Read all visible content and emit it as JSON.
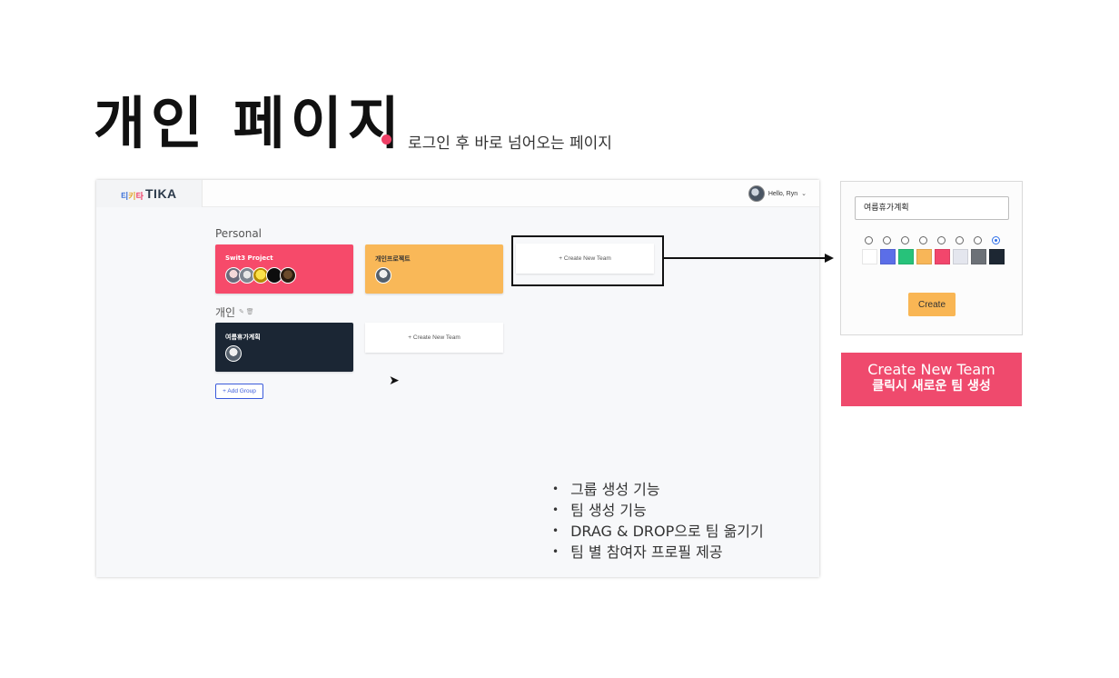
{
  "slide": {
    "title": "개인 페이지",
    "subtitle": "로그인 후 바로 넘어오는 페이지"
  },
  "app": {
    "logo_kr_1": "티",
    "logo_kr_2": "키",
    "logo_kr_3": "타",
    "logo_en": "TIKA",
    "greeting": "Hello, Ryn",
    "groups": [
      {
        "label": "Personal",
        "teams": [
          {
            "name": "Swit3 Project",
            "color": "#f64a6a"
          },
          {
            "name": "개인프로젝트",
            "color": "#f9b858"
          }
        ],
        "create_label": "+ Create New Team"
      },
      {
        "label": "개인",
        "teams": [
          {
            "name": "여름휴가계획",
            "color": "#1b2634"
          }
        ],
        "create_label": "+ Create New Team"
      }
    ],
    "edit_icons": "✎ 🗑",
    "add_group_label": "+ Add Group"
  },
  "features": [
    "그룹 생성 기능",
    "팀 생성 기능",
    "DRAG & DROP으로 팀 옮기기",
    "팀 별 참여자 프로필 제공"
  ],
  "modal": {
    "input_value": "여름휴가계획",
    "colors": [
      "#ffffff",
      "#5b6ee8",
      "#27c27a",
      "#f8b658",
      "#f2466c",
      "#e4e6ee",
      "#6c7177",
      "#1d2733"
    ],
    "selected_index": 7,
    "create_label": "Create"
  },
  "caption": {
    "line1": "Create New  Team",
    "line2": "클릭시 새로운 팀 생성"
  }
}
